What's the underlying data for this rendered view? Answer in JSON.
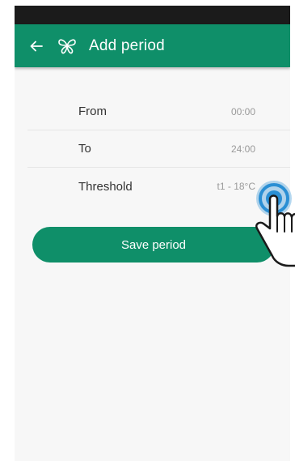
{
  "header": {
    "title": "Add period",
    "back_icon": "arrow-left-icon",
    "logo_icon": "butterfly-logo-icon"
  },
  "rows": [
    {
      "label": "From",
      "value": "00:00"
    },
    {
      "label": "To",
      "value": "24:00"
    },
    {
      "label": "Threshold",
      "value": "t1 - 18°C"
    }
  ],
  "save_button": {
    "label": "Save period"
  },
  "colors": {
    "primary": "#0f8f69",
    "background": "#f7f7f7",
    "status_bar": "#1b1b1b",
    "tap_ring": "#2a8fd4"
  }
}
